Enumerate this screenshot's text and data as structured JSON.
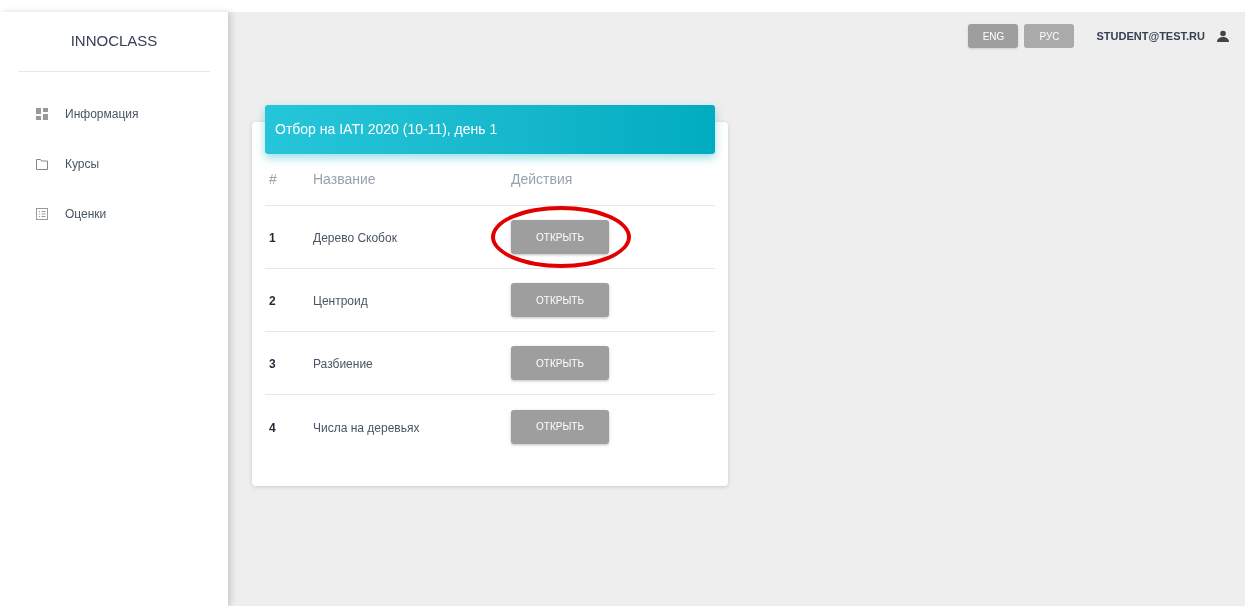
{
  "sidebar": {
    "brand": "INNOCLASS",
    "items": [
      {
        "label": "Информация",
        "kind": "dashboard"
      },
      {
        "label": "Курсы",
        "kind": "folder"
      },
      {
        "label": "Оценки",
        "kind": "list"
      }
    ]
  },
  "header": {
    "languages": [
      {
        "label": "ENG",
        "selected": true
      },
      {
        "label": "РУС",
        "selected": false
      }
    ],
    "user": "STUDENT@TEST.RU"
  },
  "card": {
    "title": "Отбор на IATI 2020 (10-11), день 1",
    "columns": [
      "#",
      "Название",
      "Действия"
    ],
    "rows": [
      {
        "number": "1",
        "name": "Дерево Скобок",
        "action": "ОТКРЫТЬ",
        "circled": true
      },
      {
        "number": "2",
        "name": "Центроид",
        "action": "ОТКРЫТЬ",
        "circled": false
      },
      {
        "number": "3",
        "name": "Разбиение",
        "action": "ОТКРЫТЬ",
        "circled": false
      },
      {
        "number": "4",
        "name": "Числа на деревьях",
        "action": "ОТКРЫТЬ",
        "circled": false
      }
    ]
  }
}
